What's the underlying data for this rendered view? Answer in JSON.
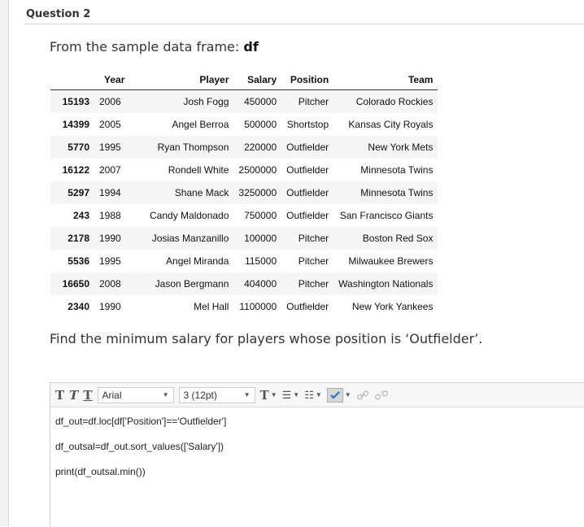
{
  "question_title": "Question 2",
  "prompt_text": "From the sample data frame: ",
  "prompt_df": "df",
  "table": {
    "columns": [
      "",
      "Year",
      "Player",
      "Salary",
      "Position",
      "Team"
    ],
    "rows": [
      [
        "15193",
        "2006",
        "Josh Fogg",
        "450000",
        "Pitcher",
        "Colorado Rockies"
      ],
      [
        "14399",
        "2005",
        "Angel Berroa",
        "500000",
        "Shortstop",
        "Kansas City Royals"
      ],
      [
        "5770",
        "1995",
        "Ryan Thompson",
        "220000",
        "Outfielder",
        "New York Mets"
      ],
      [
        "16122",
        "2007",
        "Rondell White",
        "2500000",
        "Outfielder",
        "Minnesota Twins"
      ],
      [
        "5297",
        "1994",
        "Shane Mack",
        "3250000",
        "Outfielder",
        "Minnesota Twins"
      ],
      [
        "243",
        "1988",
        "Candy Maldonado",
        "750000",
        "Outfielder",
        "San Francisco Giants"
      ],
      [
        "2178",
        "1990",
        "Josias Manzanillo",
        "100000",
        "Pitcher",
        "Boston Red Sox"
      ],
      [
        "5536",
        "1995",
        "Angel Miranda",
        "115000",
        "Pitcher",
        "Milwaukee Brewers"
      ],
      [
        "16650",
        "2008",
        "Jason Bergmann",
        "404000",
        "Pitcher",
        "Washington Nationals"
      ],
      [
        "2340",
        "1990",
        "Mel Hall",
        "1100000",
        "Outfielder",
        "New York Yankees"
      ]
    ]
  },
  "question_text": "Find the minimum salary for players whose position is ‘Outfielder’.",
  "editor": {
    "font_family": "Arial",
    "font_size": "3 (12pt)",
    "code_lines": [
      "df_out=df.loc[df['Position']=='Outfielder']",
      "df_outsal=df_out.sort_values(['Salary'])",
      "print(df_outsal.min())"
    ]
  },
  "icons": {
    "bold": "bold-T-icon",
    "italic": "italic-T-icon",
    "underline": "underline-T-icon",
    "text_color": "text-color-icon",
    "bullet_list": "bullet-list-icon",
    "numbered_list": "numbered-list-icon",
    "spellcheck": "spellcheck-icon",
    "link": "link-icon",
    "unlink": "unlink-icon"
  }
}
